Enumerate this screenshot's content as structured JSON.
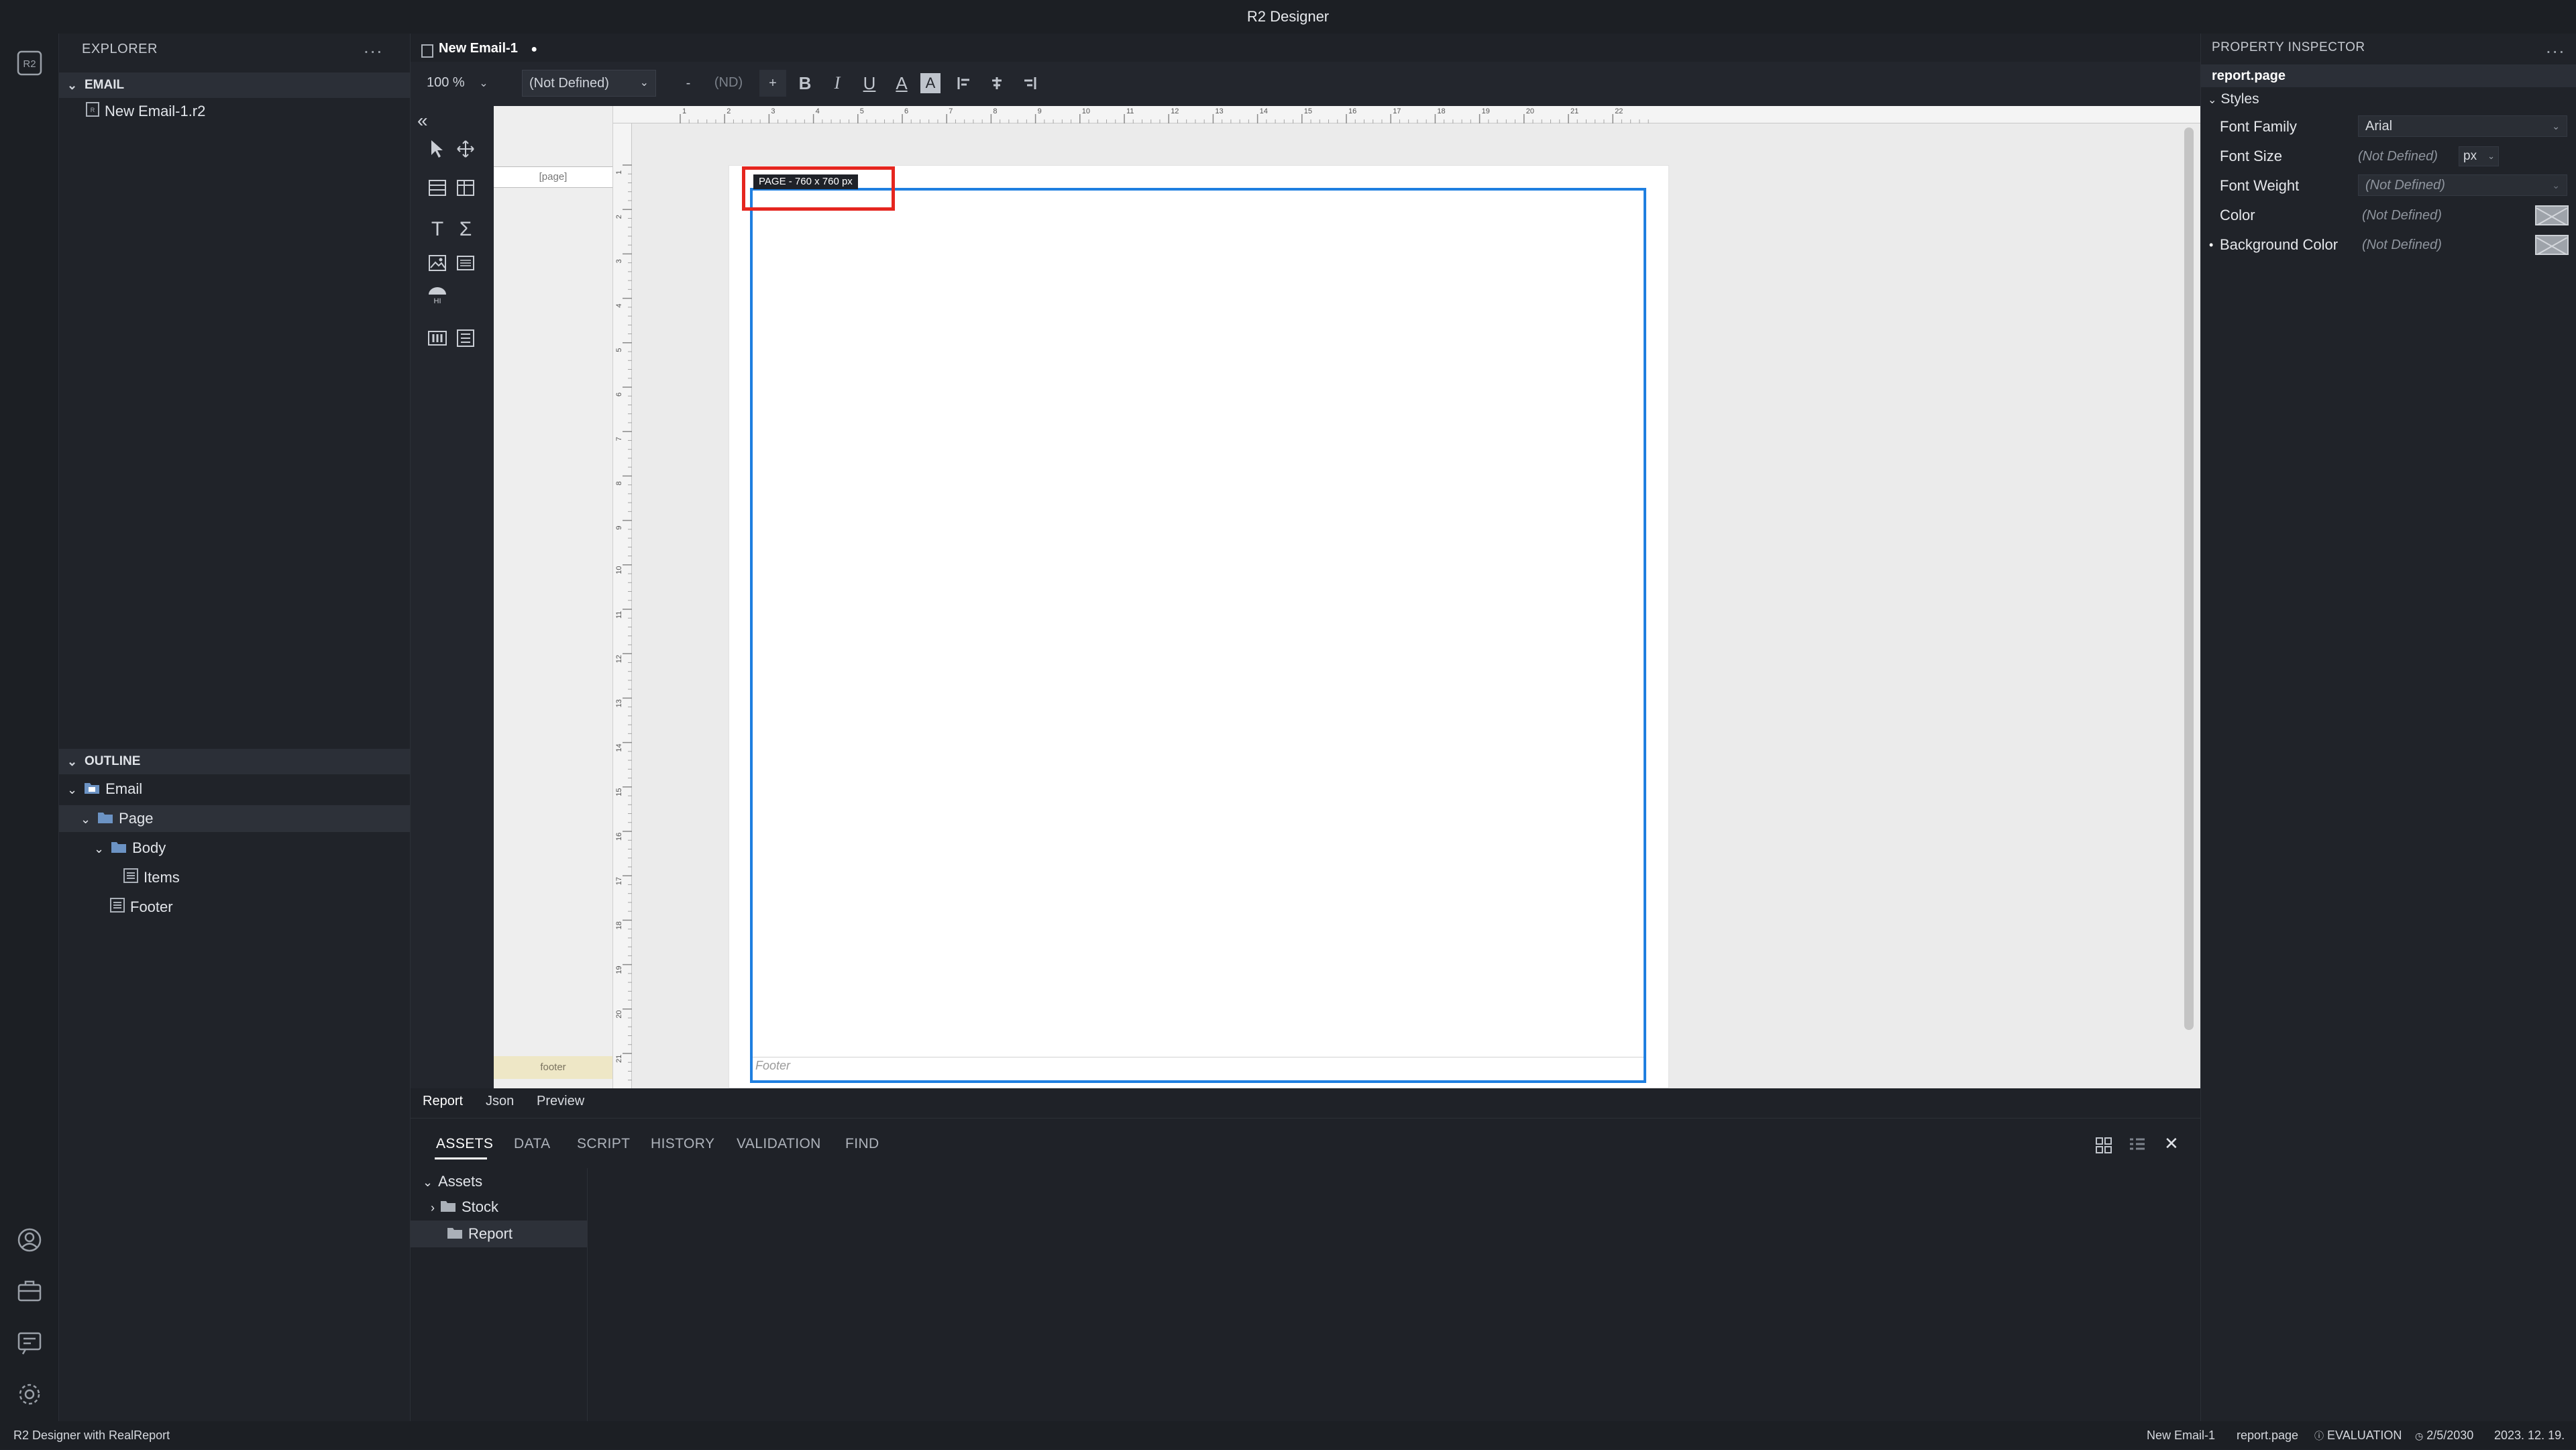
{
  "app": {
    "title": "R2 Designer"
  },
  "activity_bar": {
    "logo": "r2-logo-icon",
    "bottom_icons": [
      "user-icon",
      "briefcase-icon",
      "feedback-icon",
      "gear-icon"
    ]
  },
  "explorer": {
    "title": "EXPLORER",
    "more": "...",
    "email_section": "EMAIL",
    "files": [
      "New Email-1.r2"
    ],
    "outline_section": "OUTLINE",
    "outline": [
      {
        "label": "Email",
        "icon": "email-folder-icon"
      },
      {
        "label": "Page",
        "icon": "folder-icon"
      },
      {
        "label": "Body",
        "icon": "folder-icon"
      },
      {
        "label": "Items",
        "icon": "list-icon"
      },
      {
        "label": "Footer",
        "icon": "list-icon"
      }
    ]
  },
  "editor": {
    "tab_label": "New Email-1",
    "tab_dirty": "●",
    "toolbar": {
      "zoom": "100 %",
      "font_family": "(Not Defined)",
      "minus": "-",
      "font_size": "(ND)",
      "plus": "+",
      "bold": "B",
      "italic": "I",
      "underline": "U",
      "font_color": "A",
      "back_color": "A"
    },
    "collapse": "«",
    "bands": {
      "page": "[page]",
      "footer": "footer"
    },
    "ruler_h": [
      "1",
      "2",
      "3",
      "4",
      "5",
      "6",
      "7",
      "8",
      "9",
      "10",
      "11",
      "12",
      "13",
      "14",
      "15",
      "16",
      "17",
      "18",
      "19",
      "20",
      "21",
      "22"
    ],
    "ruler_v": [
      "1",
      "2",
      "3",
      "4",
      "5",
      "6",
      "7",
      "8",
      "9",
      "10",
      "11",
      "12",
      "13",
      "14",
      "15",
      "16",
      "17",
      "18",
      "19",
      "20",
      "21"
    ],
    "page_label": "PAGE - 760 x 760 px",
    "footer_text": "Footer",
    "view_tabs": [
      "Report",
      "Json",
      "Preview"
    ]
  },
  "bottom_panel": {
    "tabs": [
      "ASSETS",
      "DATA",
      "SCRIPT",
      "HISTORY",
      "VALIDATION",
      "FIND"
    ],
    "close": "✕",
    "tree": {
      "root": "Assets",
      "children": [
        "Stock",
        "Report"
      ]
    }
  },
  "inspector": {
    "title": "PROPERTY INSPECTOR",
    "more": "...",
    "target": "report.page",
    "group": "Styles",
    "props": {
      "font_family": {
        "label": "Font Family",
        "value": "Arial"
      },
      "font_size": {
        "label": "Font Size",
        "value": "(Not Defined)",
        "unit": "px"
      },
      "font_weight": {
        "label": "Font Weight",
        "value": "(Not Defined)"
      },
      "color": {
        "label": "Color",
        "value": "(Not Defined)"
      },
      "background_color": {
        "label": "Background Color",
        "value": "(Not Defined)",
        "marker": "•"
      }
    }
  },
  "status_bar": {
    "left": "R2 Designer with RealReport",
    "doc": "New Email-1",
    "target": "report.page",
    "license": "EVALUATION",
    "expiry": "2/5/2030",
    "date": "2023. 12. 19."
  },
  "colors": {
    "selection": "#1f7fe0",
    "highlight": "#e5261f",
    "footer_band": "#eee7c6"
  }
}
